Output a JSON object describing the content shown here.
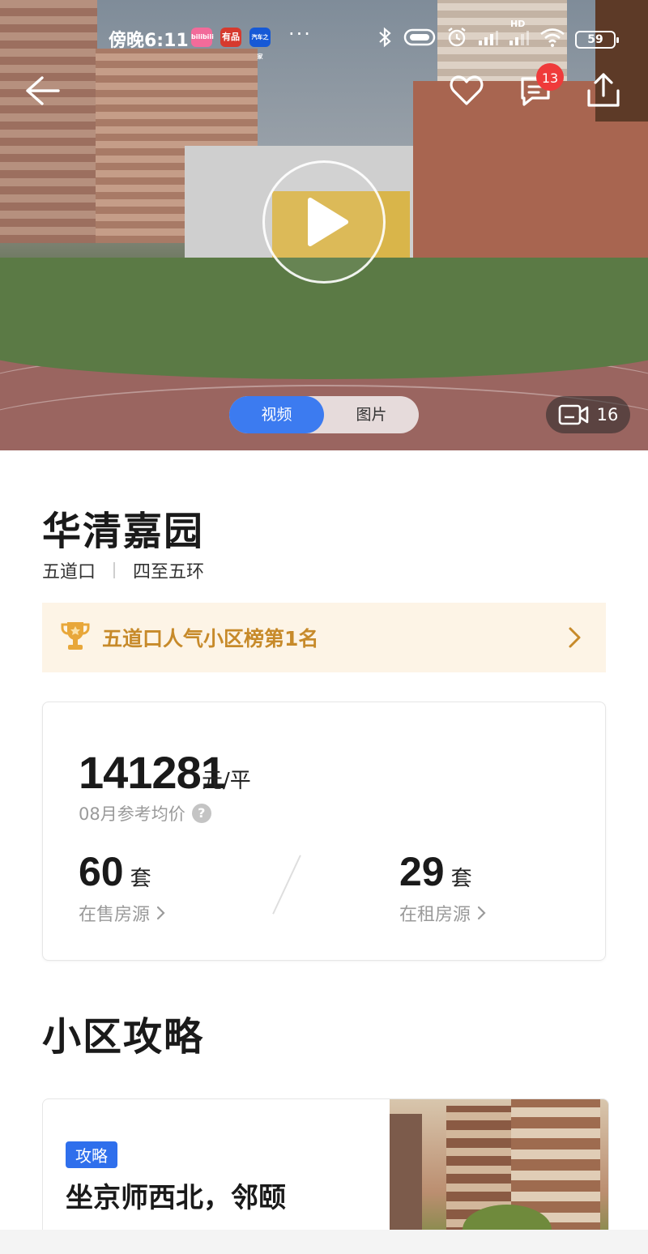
{
  "status_bar": {
    "time": "傍晚6:11",
    "app_icons": [
      {
        "name": "bilibili-icon",
        "label": "bilibili",
        "color": "#f26b9a"
      },
      {
        "name": "youpin-icon",
        "label": "有品",
        "color": "#d63a2e"
      },
      {
        "name": "autohome-icon",
        "label": "汽车之家",
        "color": "#1659d6"
      }
    ],
    "more": "···",
    "network": "HD",
    "battery": "59"
  },
  "header": {
    "message_badge": "13"
  },
  "media": {
    "tabs": [
      {
        "label": "视频",
        "active": true
      },
      {
        "label": "图片",
        "active": false
      }
    ],
    "video_count": "16"
  },
  "community": {
    "name": "华清嘉园",
    "area": "五道口",
    "ring": "四至五环"
  },
  "rank": {
    "text": "五道口人气小区榜第1名"
  },
  "price": {
    "value": "141281",
    "unit": "元/平",
    "label": "08月参考均价"
  },
  "listings": {
    "sale_count": "60",
    "sale_unit": "套",
    "sale_label": "在售房源",
    "rent_count": "29",
    "rent_unit": "套",
    "rent_label": "在租房源"
  },
  "guide_section": {
    "title": "小区攻略",
    "card": {
      "tag": "攻略",
      "title": "坐京师西北，邻颐"
    }
  },
  "colors": {
    "accent_blue": "#3c7bf0",
    "rank_gold": "#c78a2a",
    "rank_bg": "#fdf4e6",
    "badge_red": "#ef3a3a"
  }
}
